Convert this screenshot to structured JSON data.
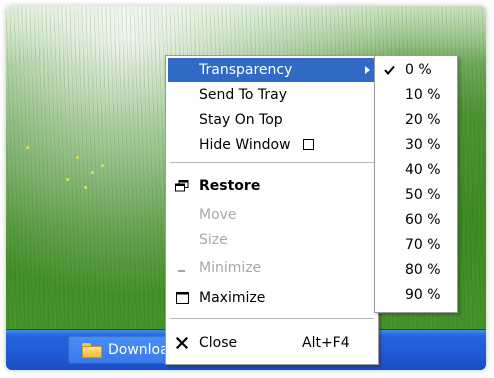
{
  "context_menu": {
    "items": [
      {
        "label": "Transparency",
        "has_submenu": true,
        "state": "highlighted"
      },
      {
        "label": "Send To Tray"
      },
      {
        "label": "Stay On Top"
      },
      {
        "label": "Hide Window",
        "checkbox": true,
        "checked": false
      },
      {
        "label": "Restore",
        "icon": "restore-window-icon",
        "bold": true
      },
      {
        "label": "Move",
        "disabled": true
      },
      {
        "label": "Size",
        "disabled": true
      },
      {
        "label": "Minimize",
        "icon": "minimize-icon",
        "disabled": true
      },
      {
        "label": "Maximize",
        "icon": "maximize-icon"
      },
      {
        "label": "Close",
        "icon": "close-icon",
        "shortcut": "Alt+F4"
      }
    ]
  },
  "transparency_submenu": {
    "selected": "0 %",
    "items": [
      "0 %",
      "10 %",
      "20 %",
      "30 %",
      "40 %",
      "50 %",
      "60 %",
      "70 %",
      "80 %",
      "90 %"
    ]
  },
  "taskbar": {
    "button_label": "Downloads",
    "button_icon": "folder-icon"
  },
  "colors": {
    "highlight": "#316ac5",
    "taskbar": "#2159d6",
    "disabled_text": "#a9a9a9"
  }
}
